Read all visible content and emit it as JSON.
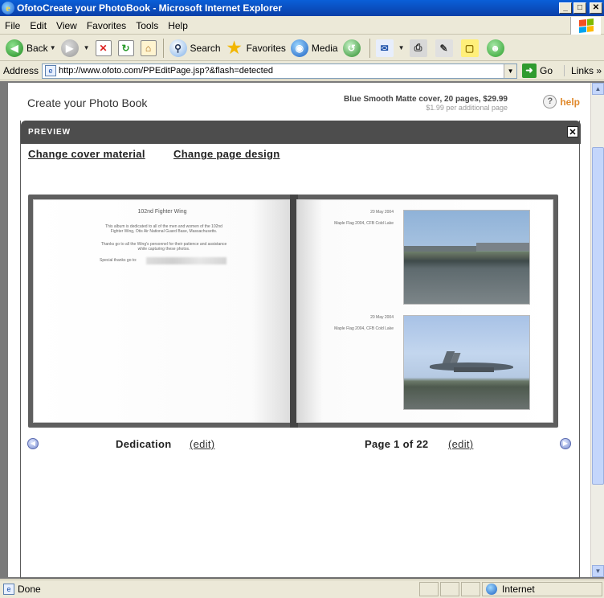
{
  "window": {
    "title": "OfotoCreate your PhotoBook - Microsoft Internet Explorer",
    "min": "_",
    "max": "□",
    "close": "✕"
  },
  "menu": [
    "File",
    "Edit",
    "View",
    "Favorites",
    "Tools",
    "Help"
  ],
  "toolbar": {
    "back": "Back",
    "search": "Search",
    "favorites": "Favorites",
    "media": "Media",
    "icons": [
      "back-icon",
      "forward-icon",
      "stop-icon",
      "refresh-icon",
      "home-icon",
      "search-icon",
      "favorites-star-icon",
      "media-icon",
      "history-icon",
      "mail-icon",
      "print-icon",
      "edit-icon",
      "discuss-icon",
      "messenger-icon"
    ]
  },
  "address": {
    "label": "Address",
    "url": "http://www.ofoto.com/PPEditPage.jsp?&flash=detected",
    "go": "Go",
    "links": "Links"
  },
  "page": {
    "title": "Create your Photo Book",
    "price_main": "Blue Smooth Matte cover, 20 pages, $29.99",
    "price_sub": "$1.99 per additional page",
    "help": "help"
  },
  "preview": {
    "header": "PREVIEW",
    "close": "✕",
    "link_cover": "Change cover material",
    "link_design": "Change page design"
  },
  "book": {
    "left": {
      "title": "102nd Fighter Wing",
      "para1": "This album is dedicated to all of the men and women of the 102nd Fighter Wing, Otis Air National Guard Base, Massachusetts.",
      "para2": "Thanks go to all the Wing's personnel for their patience and assistance while capturing these photos.",
      "para3": "Special thanks go to:"
    },
    "right": {
      "date1": "20 May 2004",
      "caption1": "Maple Flag 2004, CFB Cold Lake",
      "date2": "20 May 2004",
      "caption2": "Maple Flag 2004, CFB Cold Lake"
    }
  },
  "nav": {
    "left_caption": "Dedication",
    "left_edit": "(edit)",
    "right_caption": "Page 1 of 22",
    "right_edit": "(edit)"
  },
  "status": {
    "text": "Done",
    "zone": "Internet"
  }
}
